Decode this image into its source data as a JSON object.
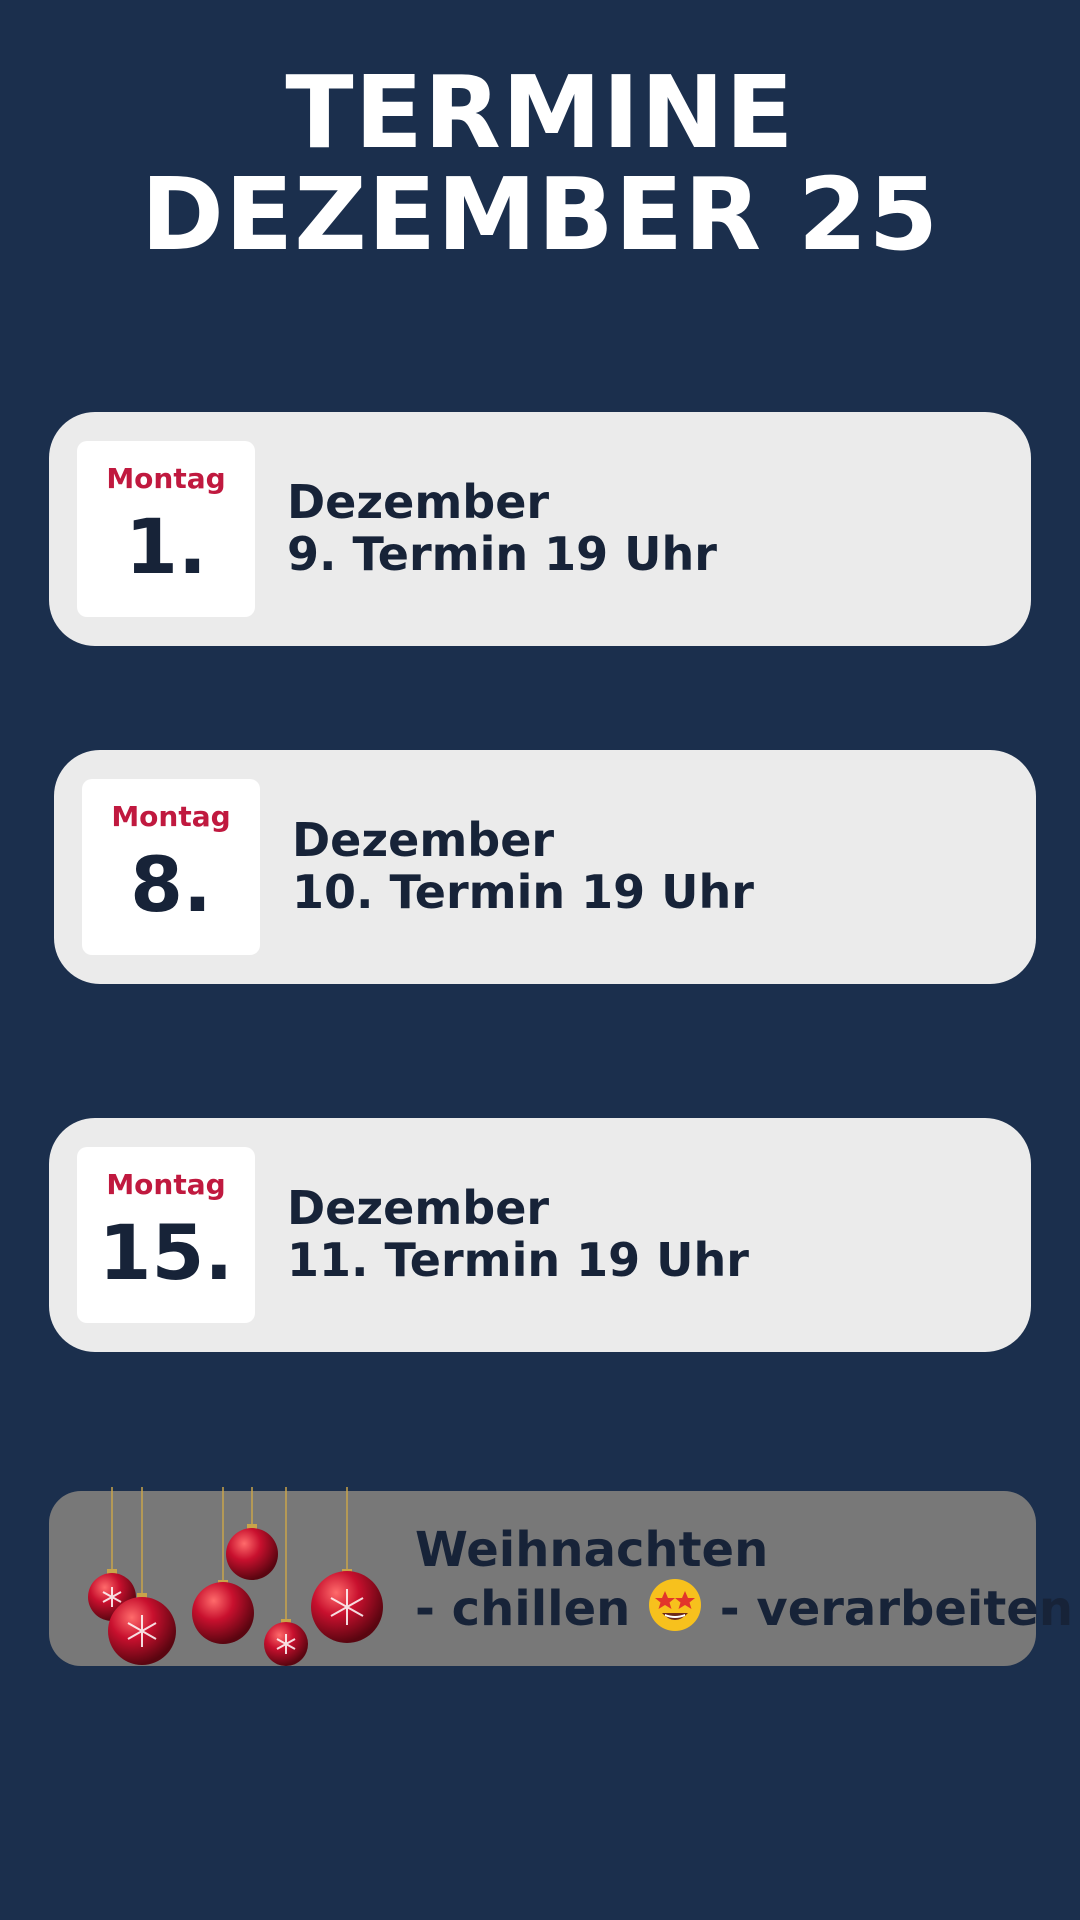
{
  "header": {
    "title_line1": "TERMINE",
    "title_line2": "DEZEMBER 25"
  },
  "appointments": [
    {
      "weekday": "Montag",
      "day": "1.",
      "month": "Dezember",
      "detail": "9. Termin 19 Uhr"
    },
    {
      "weekday": "Montag",
      "day": "8.",
      "month": "Dezember",
      "detail": "10. Termin 19 Uhr"
    },
    {
      "weekday": "Montag",
      "day": "15.",
      "month": "Dezember",
      "detail": "11. Termin 19 Uhr"
    }
  ],
  "holiday": {
    "title": "Weihnachten",
    "line_part1": "- chillen",
    "emoji": "star-struck-emoji-icon",
    "line_part2": "- verarbeiten",
    "decoration": "christmas-ornaments-icon"
  },
  "colors": {
    "background": "#1b2f4d",
    "card": "#ebebeb",
    "weekday": "#c0193f",
    "text": "#172338",
    "holiday_card": "#787878"
  }
}
